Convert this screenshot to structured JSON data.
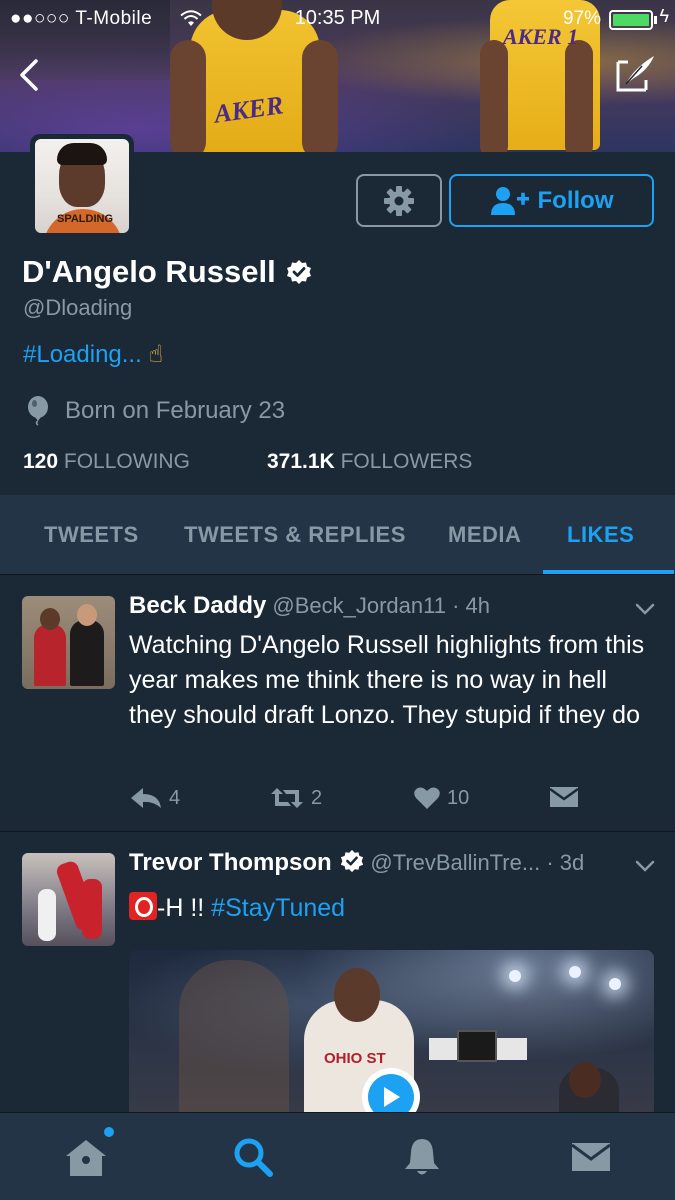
{
  "status_bar": {
    "carrier": "●●○○○ T-Mobile",
    "time": "10:35 PM",
    "battery_percent": "97%",
    "battery_level": 0.97
  },
  "profile": {
    "name": "D'Angelo Russell",
    "handle": "@Dloading",
    "bio": "#Loading...",
    "bio_emoji": "☝",
    "location": "Born on February 23",
    "following_count": "120",
    "following_label": "FOLLOWING",
    "followers_count": "371.1K",
    "followers_label": "FOLLOWERS",
    "follow_label": "Follow"
  },
  "tabs": [
    {
      "label": "TWEETS",
      "active": false
    },
    {
      "label": "TWEETS & REPLIES",
      "active": false
    },
    {
      "label": "MEDIA",
      "active": false
    },
    {
      "label": "LIKES",
      "active": true
    }
  ],
  "tweets": [
    {
      "author": "Beck Daddy",
      "meta": "@Beck_Jordan11 · 4h",
      "text": "Watching D'Angelo Russell highlights from this year makes me think there is no way in hell they should draft Lonzo. They stupid if they do",
      "replies": "4",
      "retweets": "2",
      "likes": "10"
    },
    {
      "author": "Trevor Thompson",
      "meta": "@TrevBallinTre... · 3d",
      "text_after_badge": "-H !! ",
      "hashtag": "#StayTuned",
      "media_jersey_text": "OHIO ST"
    }
  ],
  "colors": {
    "background": "#1b2836",
    "panel": "#243447",
    "accent": "#1da1f2",
    "muted": "#8899a6"
  }
}
